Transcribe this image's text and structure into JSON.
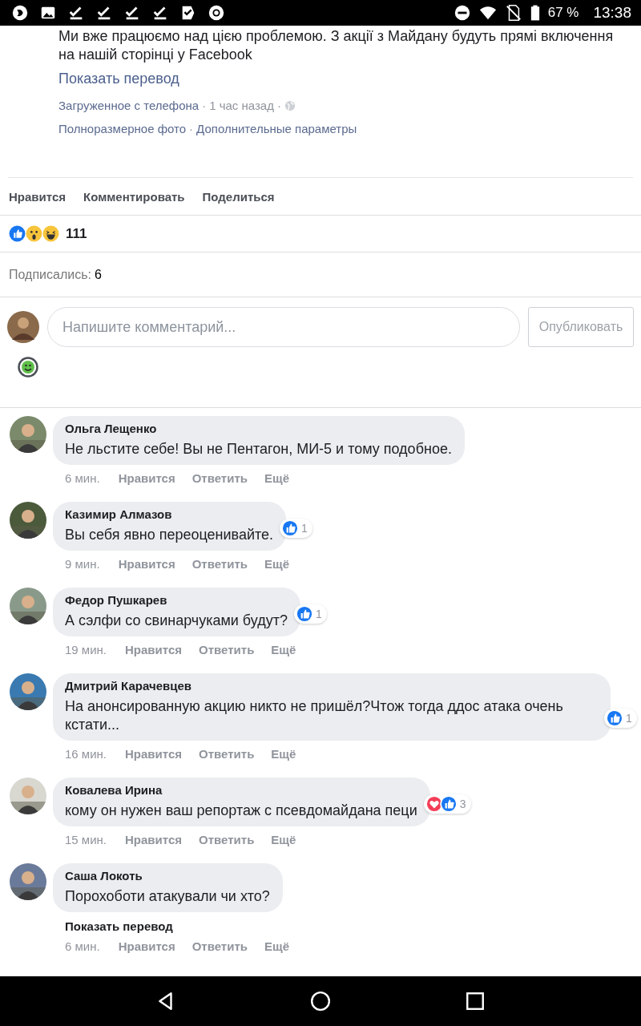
{
  "status_bar": {
    "battery": "67 %",
    "time": "13:38"
  },
  "post": {
    "text": "Ми вже працюємо над цією проблемою. З акції з Майдану будуть прямі включення на нашій сторінці у Facebook",
    "translate": "Показать перевод",
    "meta": [
      {
        "kind": "link",
        "text": "Загруженное с телефона"
      },
      {
        "kind": "separator",
        "text": "·"
      },
      {
        "kind": "plain",
        "text": "1 час назад"
      },
      {
        "kind": "separator",
        "text": "·"
      }
    ],
    "links": [
      {
        "kind": "link",
        "text": "Полноразмерное фото"
      },
      {
        "kind": "separator",
        "text": "·"
      },
      {
        "kind": "link",
        "text": "Дополнительные параметры"
      }
    ]
  },
  "actions": [
    "Нравится",
    "Комментировать",
    "Поделиться"
  ],
  "reactions": {
    "kinds": [
      {
        "kind": "like"
      },
      {
        "kind": "wow"
      },
      {
        "kind": "haha"
      }
    ],
    "count": "111"
  },
  "shares": {
    "label": "Подписались:",
    "count": "6"
  },
  "composer": {
    "placeholder": "Напишите комментарий...",
    "button": "Опубликовать"
  },
  "comments": [
    {
      "author": "Ольга Лещенко",
      "text": "Не льстите себе! Вы не Пентагон, МИ-5 и тому подобное.",
      "time": "6 мин.",
      "actions": [
        "Нравится",
        "Ответить",
        "Ещё"
      ]
    },
    {
      "author": "Казимир Алмазов",
      "text": "Вы себя явно переоценивайте.",
      "reactions": [
        {
          "kind": "like"
        }
      ],
      "count": "1",
      "time": "9 мин.",
      "actions": [
        "Нравится",
        "Ответить",
        "Ещё"
      ]
    },
    {
      "author": "Федор Пушкарев",
      "text": "А сэлфи со свинарчуками будут?",
      "reactions": [
        {
          "kind": "like"
        }
      ],
      "count": "1",
      "time": "19 мин.",
      "actions": [
        "Нравится",
        "Ответить",
        "Ещё"
      ]
    },
    {
      "author": "Дмитрий Карачевцев",
      "text": "На анонсированную акцию никто не пришёл?Чтож тогда ддос атака очень кстати...",
      "reactions": [
        {
          "kind": "like"
        }
      ],
      "count": "1",
      "time": "16 мин.",
      "actions": [
        "Нравится",
        "Ответить",
        "Ещё"
      ]
    },
    {
      "author": "Ковалева Ирина",
      "text": "кому он нужен ваш репортаж с псевдомайдана пеци",
      "reactions": [
        {
          "kind": "love"
        },
        {
          "kind": "like"
        }
      ],
      "count": "3",
      "time": "15 мин.",
      "actions": [
        "Нравится",
        "Ответить",
        "Ещё"
      ]
    },
    {
      "author": "Саша Локоть",
      "text": "Порохоботи атакували чи хто?",
      "translate": "Показать перевод",
      "time": "6 мин.",
      "actions": [
        "Нравится",
        "Ответить",
        "Ещё"
      ]
    }
  ]
}
